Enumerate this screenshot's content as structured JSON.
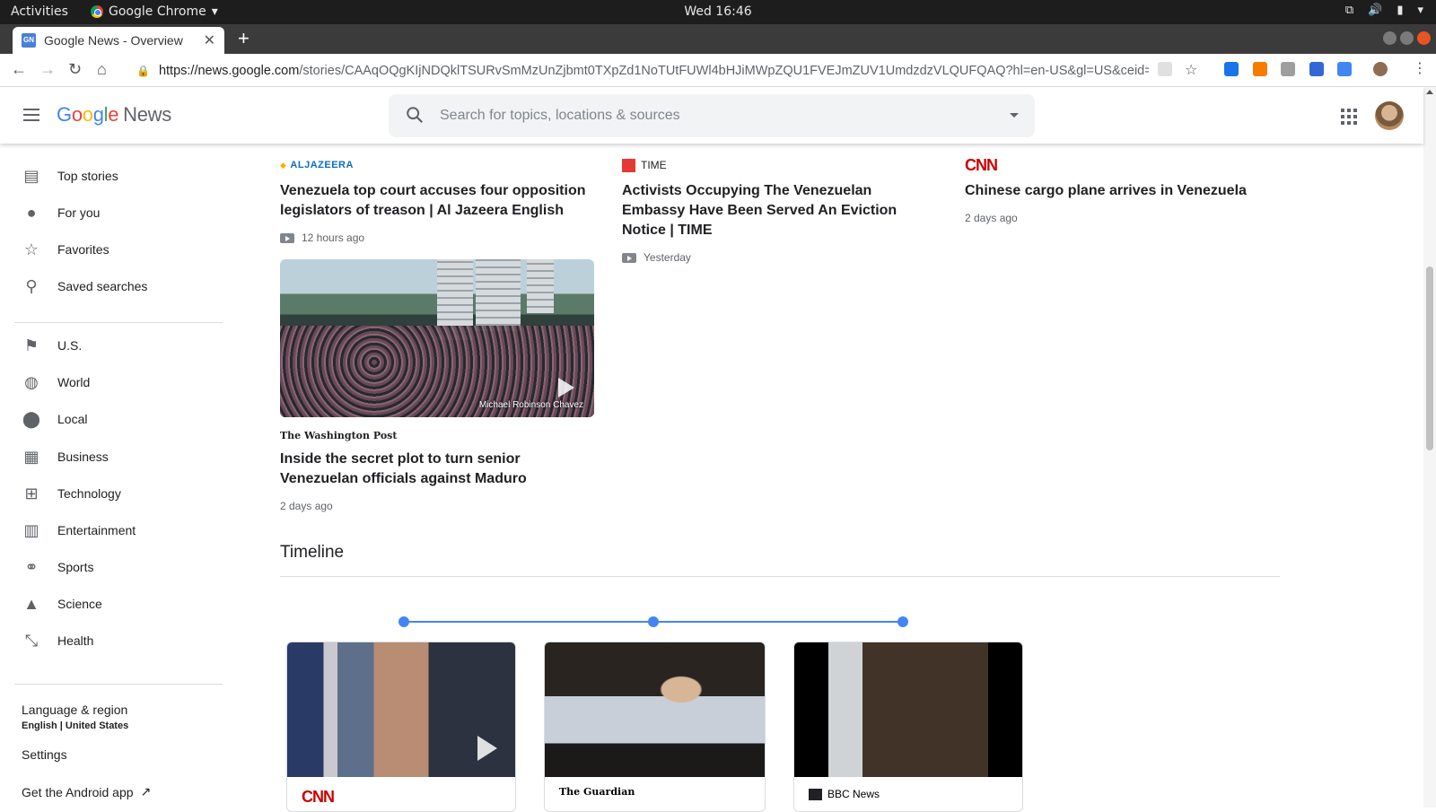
{
  "os": {
    "activities": "Activities",
    "app_name": "Google Chrome",
    "clock": "Wed 16:46"
  },
  "browser": {
    "tab_title": "Google News - Overview",
    "url_host": "https://news.google.com",
    "url_path": "/stories/CAAqOQgKIjNDQklTSURvSmMzUnZjbmt0TXpZd1NoTUtFUWl4bHJiMWpZQU1FVEJmZUV1UmdzdzVLQUFQAQ?hl=en-US&gl=US&ceid=US..."
  },
  "header": {
    "logo_letters": [
      "G",
      "o",
      "o",
      "g",
      "l",
      "e"
    ],
    "logo_suffix": "News",
    "search_placeholder": "Search for topics, locations & sources"
  },
  "sidebar": {
    "primary": [
      {
        "label": "Top stories",
        "icon": "top-stories-icon"
      },
      {
        "label": "For you",
        "icon": "person-icon"
      },
      {
        "label": "Favorites",
        "icon": "star-icon"
      },
      {
        "label": "Saved searches",
        "icon": "search-icon"
      }
    ],
    "sections": [
      {
        "label": "U.S.",
        "icon": "flag-icon"
      },
      {
        "label": "World",
        "icon": "globe-icon"
      },
      {
        "label": "Local",
        "icon": "location-pin-icon"
      },
      {
        "label": "Business",
        "icon": "building-icon"
      },
      {
        "label": "Technology",
        "icon": "chip-icon"
      },
      {
        "label": "Entertainment",
        "icon": "film-icon"
      },
      {
        "label": "Sports",
        "icon": "bike-icon"
      },
      {
        "label": "Science",
        "icon": "flask-icon"
      },
      {
        "label": "Health",
        "icon": "dumbbell-icon"
      }
    ],
    "language_label": "Language & region",
    "language_value": "English | United States",
    "settings": "Settings",
    "android_app": "Get the Android app"
  },
  "articles": [
    {
      "source": "ALJAZEERA",
      "headline": "Venezuela top court accuses four opposition legislators of treason | Al Jazeera English",
      "time": "12 hours ago",
      "video": true
    },
    {
      "source": "TIME",
      "headline": "Activists Occupying The Venezuelan Embassy Have Been Served An Eviction Notice | TIME",
      "time": "Yesterday",
      "video": true
    },
    {
      "source": "CNN",
      "headline": "Chinese cargo plane arrives in Venezuela",
      "time": "2 days ago",
      "video": false
    },
    {
      "source": "The Washington Post",
      "headline": "Inside the secret plot to turn senior Venezuelan officials against Maduro",
      "time": "2 days ago",
      "photo_credit": "Michael Robinson Chavez",
      "video": false
    }
  ],
  "timeline": {
    "title": "Timeline",
    "cards": [
      {
        "source": "CNN"
      },
      {
        "source": "The Guardian"
      },
      {
        "source": "BBC News"
      }
    ]
  },
  "colors": {
    "accent": "#4285f4",
    "text": "#202124",
    "muted": "#5f6368"
  }
}
